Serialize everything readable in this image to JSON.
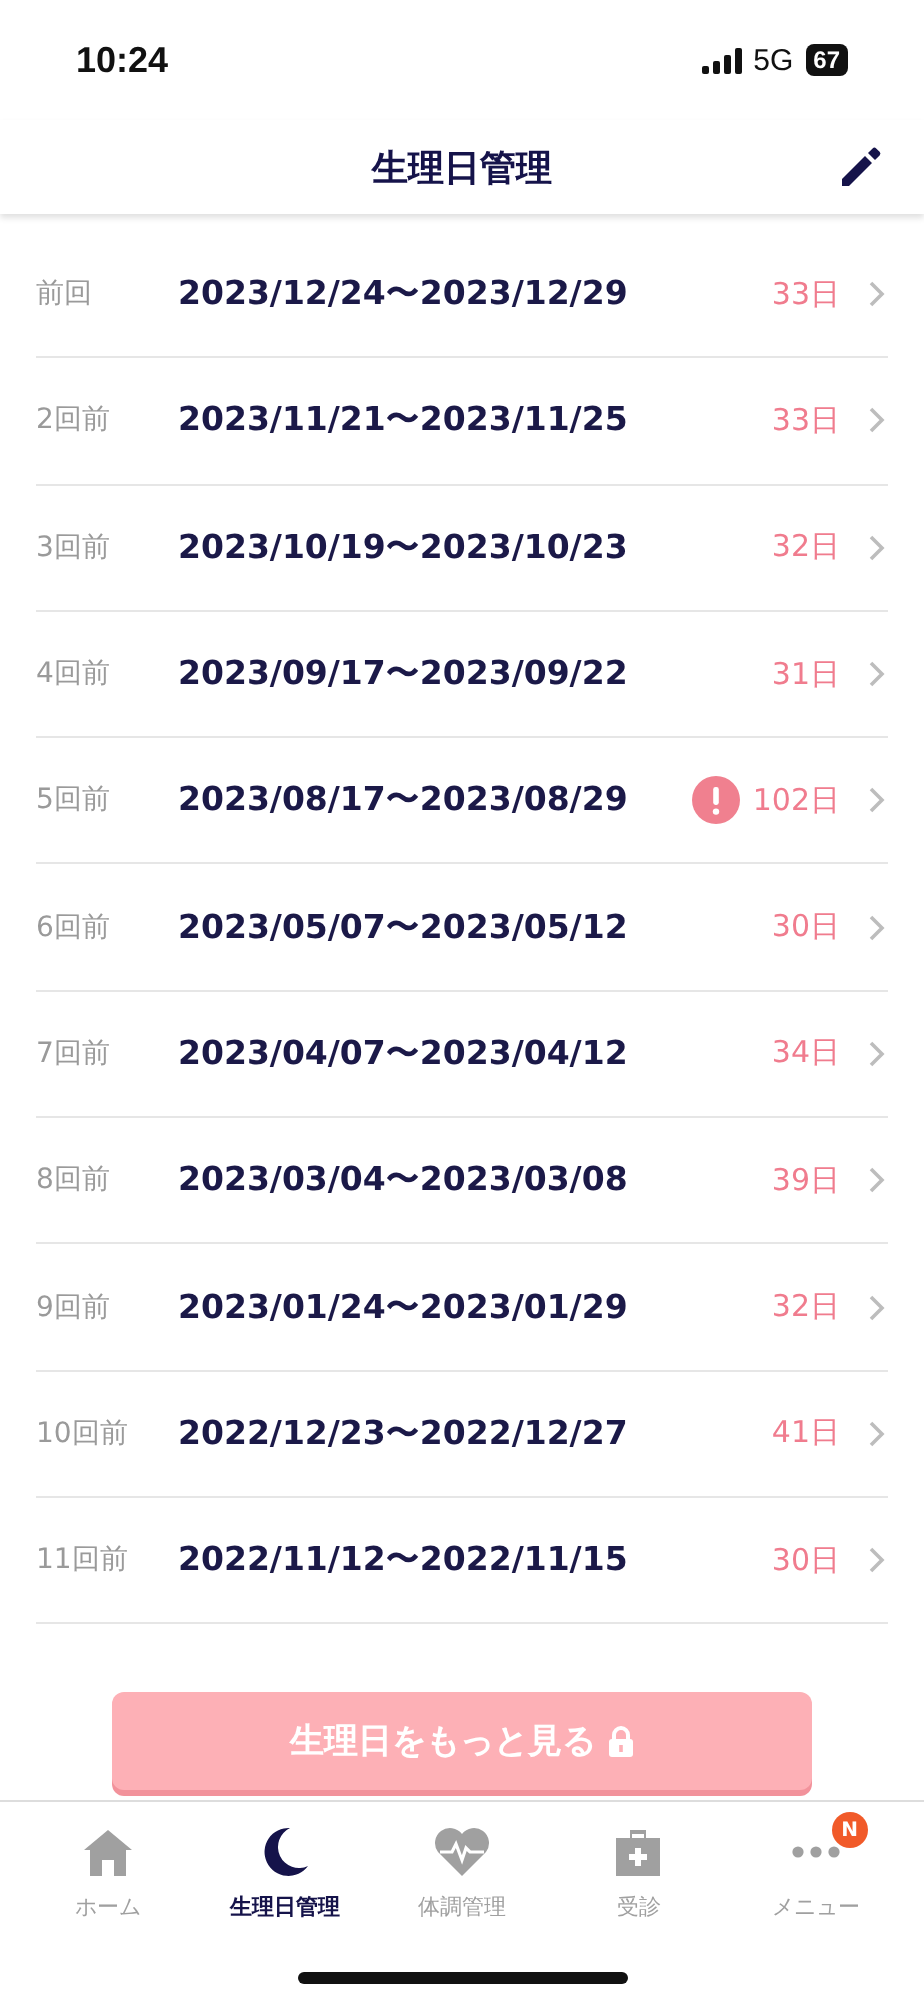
{
  "status_bar": {
    "time": "10:24",
    "network": "5G",
    "battery": "67"
  },
  "header": {
    "title": "生理日管理"
  },
  "periods": [
    {
      "label": "前回",
      "dates": "2023/12/24〜2023/12/29",
      "days": "33日",
      "warning": false
    },
    {
      "label": "2回前",
      "dates": "2023/11/21〜2023/11/25",
      "days": "33日",
      "warning": false
    },
    {
      "label": "3回前",
      "dates": "2023/10/19〜2023/10/23",
      "days": "32日",
      "warning": false
    },
    {
      "label": "4回前",
      "dates": "2023/09/17〜2023/09/22",
      "days": "31日",
      "warning": false
    },
    {
      "label": "5回前",
      "dates": "2023/08/17〜2023/08/29",
      "days": "102日",
      "warning": true
    },
    {
      "label": "6回前",
      "dates": "2023/05/07〜2023/05/12",
      "days": "30日",
      "warning": false
    },
    {
      "label": "7回前",
      "dates": "2023/04/07〜2023/04/12",
      "days": "34日",
      "warning": false
    },
    {
      "label": "8回前",
      "dates": "2023/03/04〜2023/03/08",
      "days": "39日",
      "warning": false
    },
    {
      "label": "9回前",
      "dates": "2023/01/24〜2023/01/29",
      "days": "32日",
      "warning": false
    },
    {
      "label": "10回前",
      "dates": "2022/12/23〜2022/12/27",
      "days": "41日",
      "warning": false
    },
    {
      "label": "11回前",
      "dates": "2022/11/12〜2022/11/15",
      "days": "30日",
      "warning": false
    }
  ],
  "more_button": {
    "label": "生理日をもっと見る"
  },
  "tabs": [
    {
      "kind": "home",
      "label": "ホーム",
      "selected": false
    },
    {
      "kind": "moon",
      "label": "生理日管理",
      "selected": true
    },
    {
      "kind": "heart",
      "label": "体調管理",
      "selected": false
    },
    {
      "kind": "clinic",
      "label": "受診",
      "selected": false
    },
    {
      "kind": "menu",
      "label": "メニュー",
      "selected": false,
      "badge": "N"
    }
  ]
}
